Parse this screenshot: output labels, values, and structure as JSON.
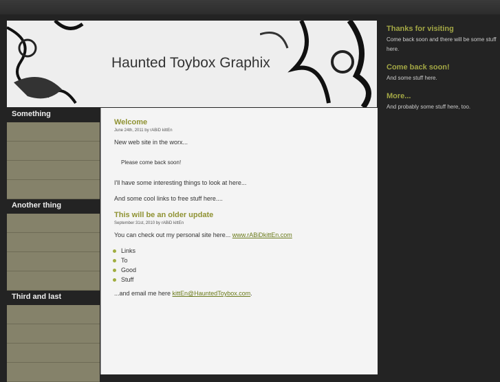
{
  "header": {
    "title": "Haunted Toybox Graphix"
  },
  "sidebar": [
    {
      "heading": "Something",
      "items": [
        "",
        "",
        "",
        ""
      ]
    },
    {
      "heading": "Another thing",
      "items": [
        "",
        "",
        "",
        ""
      ]
    },
    {
      "heading": "Third and last",
      "items": [
        "",
        "",
        "",
        ""
      ]
    }
  ],
  "posts": [
    {
      "title": "Welcome",
      "meta": "June 24th, 2011 by rABiD kittEn",
      "p1": "New web site in the worx...",
      "quote": "Please come back soon!",
      "p2": "I'll have some interesting things to look at here...",
      "p3": "And some cool links to free stuff here...."
    },
    {
      "title": "This will be an older update",
      "meta": "September 31st, 2010 by rABiD kittEn",
      "p1": "You can check out my personal site here... ",
      "link": "www.rABiDkittEn.com",
      "list": [
        "Links",
        "To",
        "Good",
        "Stuff"
      ],
      "p2": "...and email me here ",
      "email": "kittEn@HauntedToybox.com",
      "p2end": "."
    }
  ],
  "right": [
    {
      "title": "Thanks for visiting",
      "text": "Come back soon and there will be some stuff here."
    },
    {
      "title": "Come back soon!",
      "text": "And some stuff here."
    },
    {
      "title": "More...",
      "text": "And probably some stuff here, too."
    }
  ]
}
